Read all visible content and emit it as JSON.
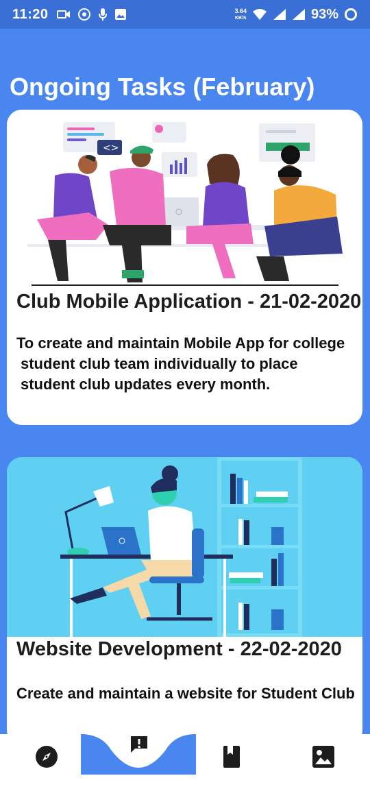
{
  "status_bar": {
    "time": "11:20",
    "speed_value": "3.64",
    "speed_unit": "KB/S",
    "battery": "93%"
  },
  "page": {
    "title": "Ongoing Tasks (February)"
  },
  "tasks": [
    {
      "title": "Club Mobile Application - 21-02-2020",
      "desc_lines": [
        "To create and maintain Mobile App for college",
        "student club  team individually to place",
        "student club updates every month."
      ]
    },
    {
      "title": "Website Development  - 22-02-2020",
      "desc": "Create and maintain a website  for Student Club"
    }
  ],
  "bottom_nav": {
    "items": [
      "compass-icon",
      "report-icon",
      "book-icon",
      "gallery-icon"
    ],
    "active": "report-icon"
  },
  "colors": {
    "background": "#4a86f0",
    "status_bar": "#3a6fd6",
    "card": "#ffffff",
    "illustration_sky": "#5fd0f2"
  }
}
